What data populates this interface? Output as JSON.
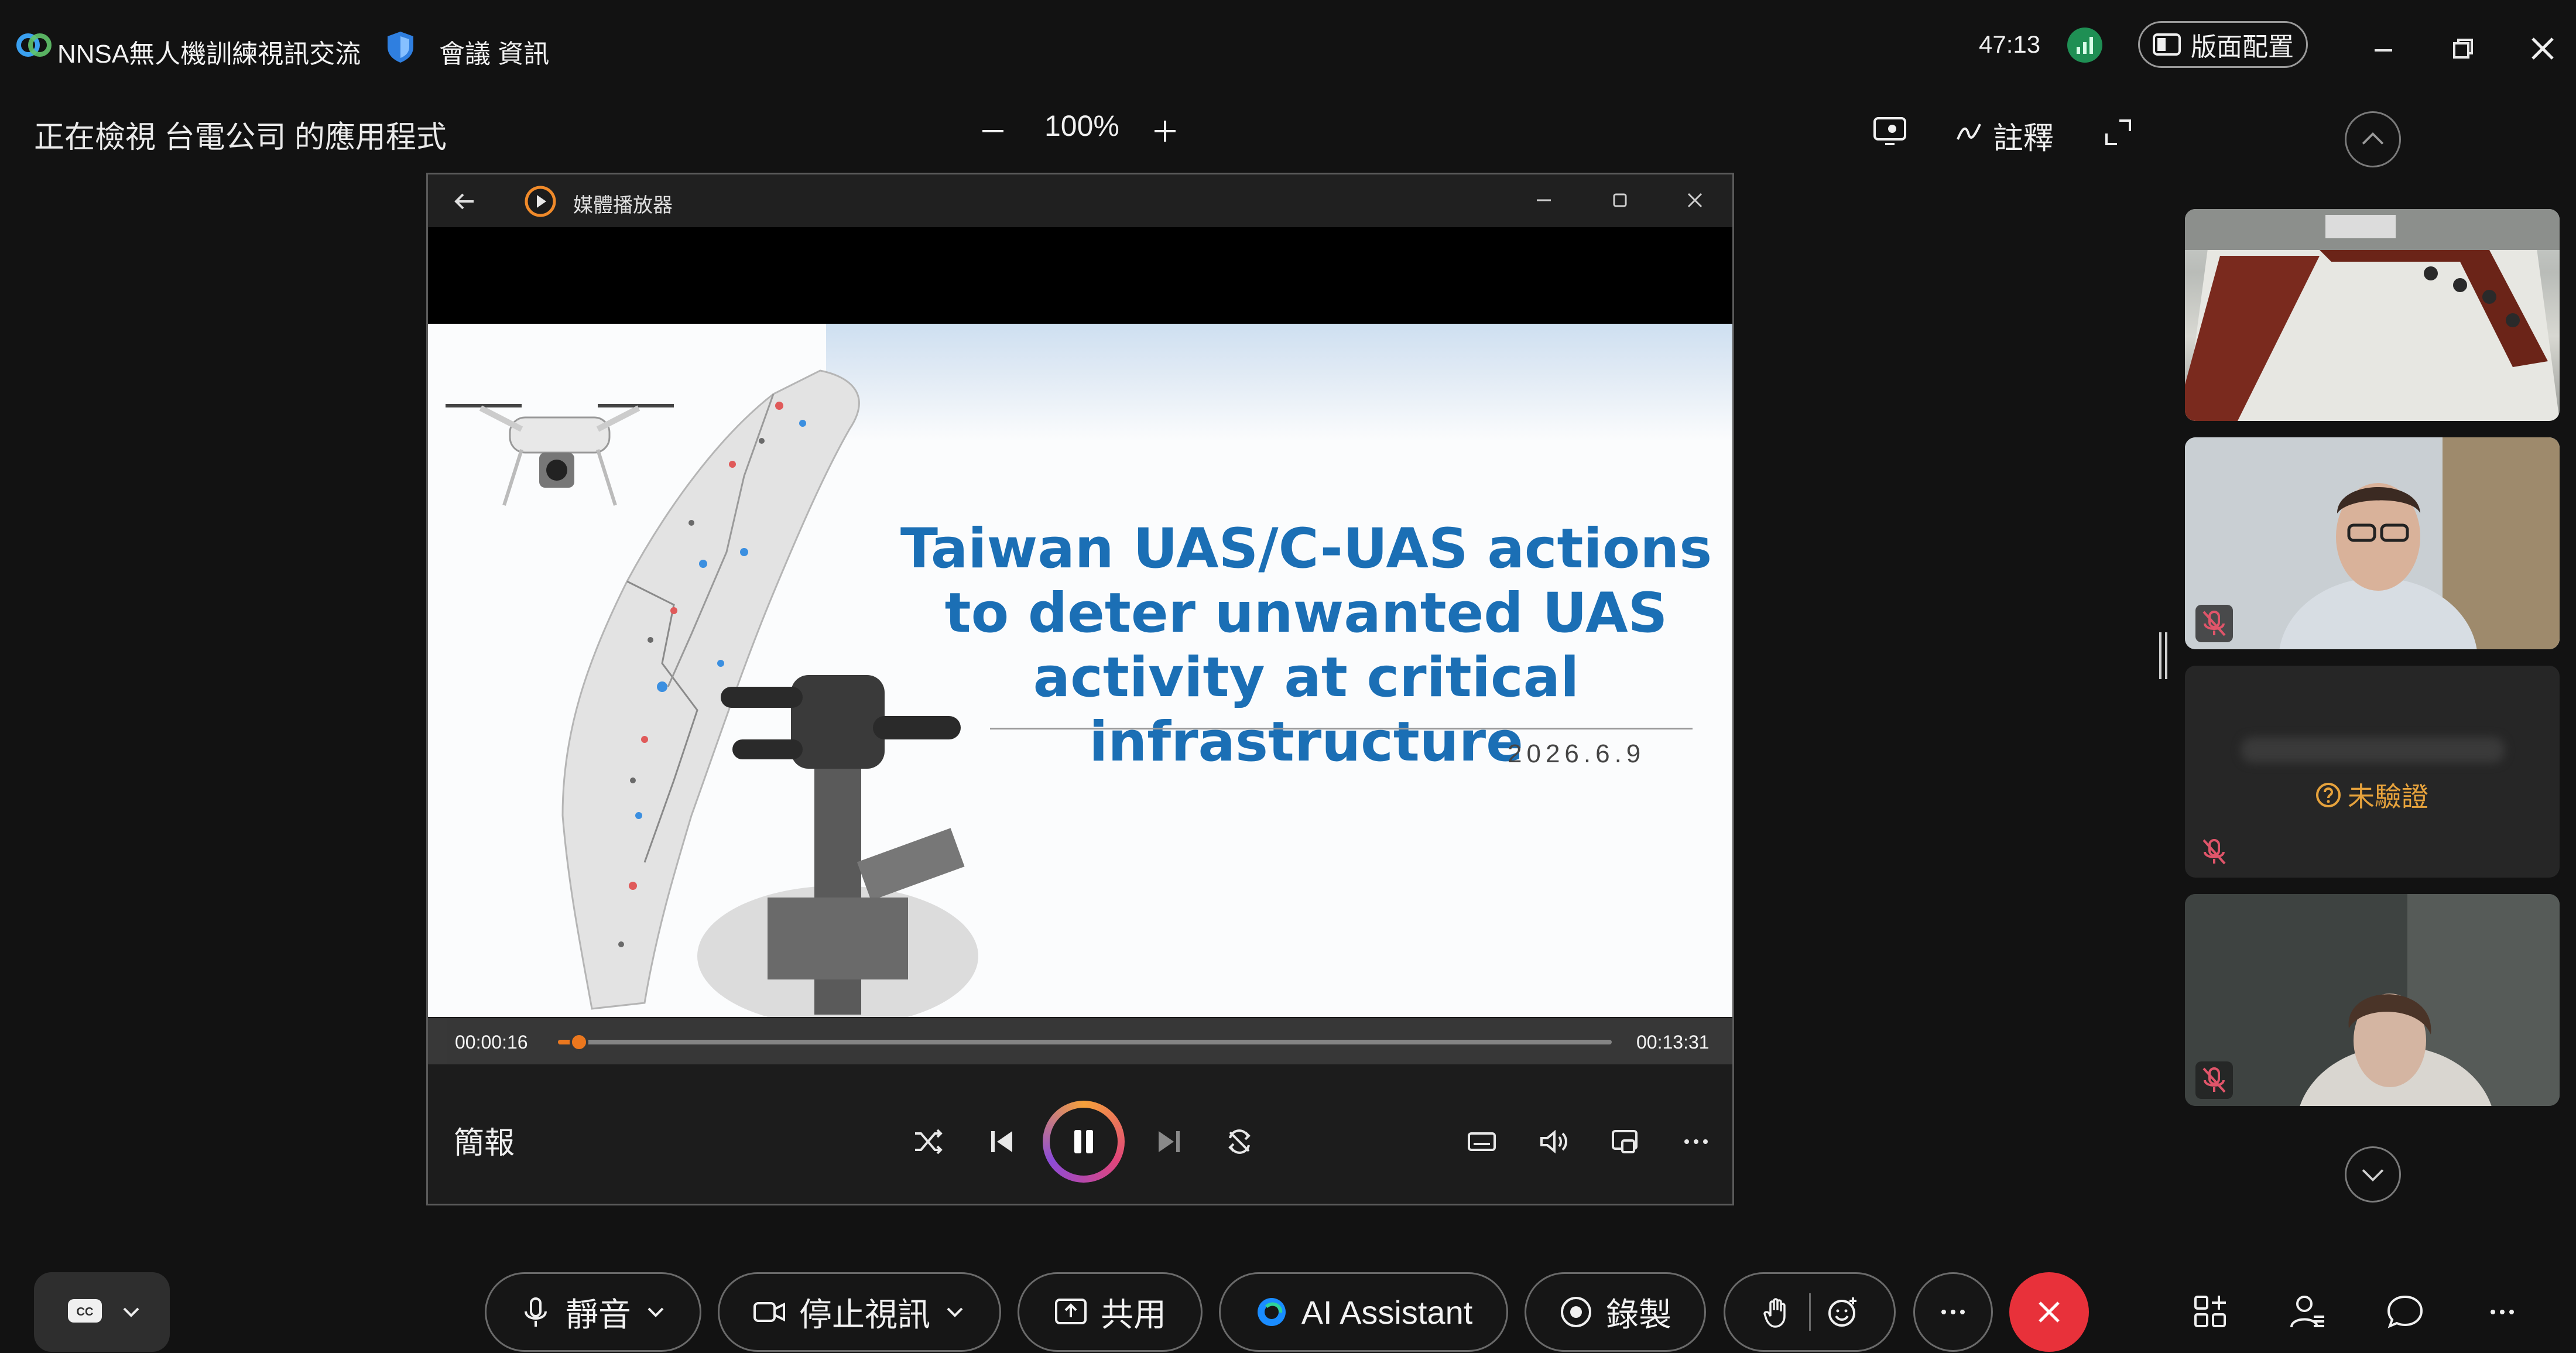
{
  "app": {
    "meeting_title": "NNSA無人機訓練視訊交流",
    "meeting_info": "會議 資訊",
    "timer": "47:13",
    "layout_button": "版面配置"
  },
  "viewing": {
    "text": "正在檢視 台電公司 的應用程式",
    "zoom_level": "100%",
    "annotate": "註釋"
  },
  "media_player": {
    "title": "媒體播放器",
    "slide": {
      "title": "Taiwan UAS/C-UAS actions to deter unwanted UAS activity at critical infrastructure",
      "date": "2026.6.9"
    },
    "elapsed": "00:00:16",
    "duration": "00:13:31",
    "progress": 0.02,
    "now_playing": "簡報"
  },
  "participants": [
    {
      "kind": "room",
      "muted": false
    },
    {
      "kind": "video",
      "muted": true
    },
    {
      "kind": "no-video",
      "status": "未驗證",
      "muted": true
    },
    {
      "kind": "video",
      "muted": true
    }
  ],
  "toolbar": {
    "mute": "靜音",
    "stop_video": "停止視訊",
    "share": "共用",
    "ai_assistant": "AI Assistant",
    "record": "錄製"
  },
  "colors": {
    "background": "#121212",
    "accent_orange": "#f57c20",
    "end_call_red": "#e8313a",
    "slide_blue": "#1b6fb5",
    "warning_amber": "#e6a23c"
  }
}
